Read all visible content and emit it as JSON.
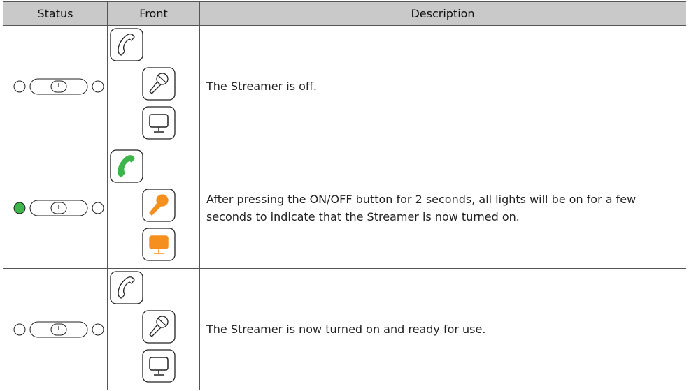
{
  "headers": {
    "status": "Status",
    "front": "Front",
    "description": "Description"
  },
  "rows": [
    {
      "left_led": "off",
      "right_led": "off",
      "phone": "off",
      "mic": "off",
      "tv": "off",
      "description": "The Streamer is off."
    },
    {
      "left_led": "green",
      "right_led": "off",
      "phone": "green",
      "mic": "orange",
      "tv": "orange",
      "description": "After pressing the ON/OFF button for 2 seconds, all lights will be on for a few seconds to indicate that the Streamer is now turned on."
    },
    {
      "left_led": "off",
      "right_led": "off",
      "phone": "off",
      "mic": "off",
      "tv": "off",
      "description": "The Streamer is now turned on and ready for use."
    }
  ],
  "colors": {
    "green": "#3db54a",
    "orange": "#f5901e",
    "header_bg": "#c9c9c9",
    "border": "#555555"
  }
}
